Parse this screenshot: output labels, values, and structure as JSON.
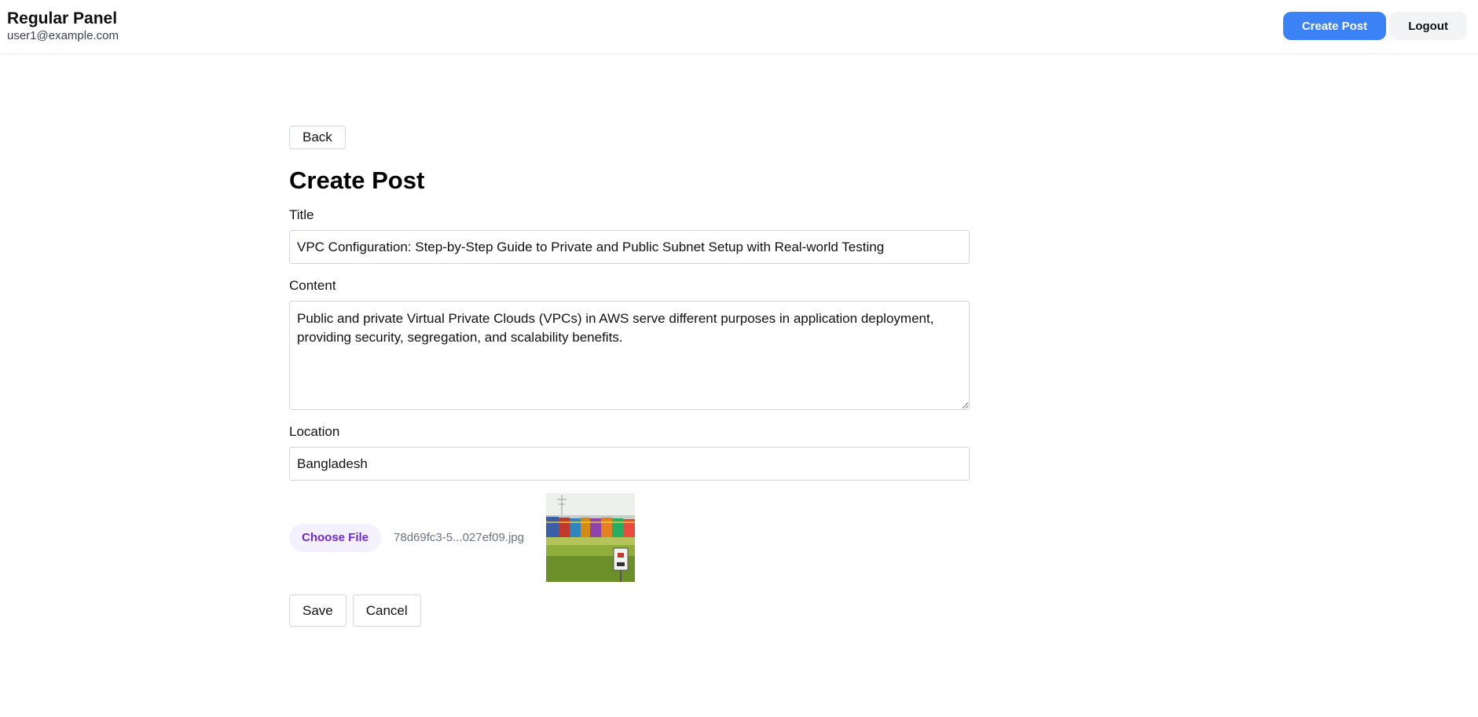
{
  "header": {
    "title": "Regular Panel",
    "email": "user1@example.com",
    "create_post_label": "Create Post",
    "logout_label": "Logout"
  },
  "form": {
    "back_label": "Back",
    "heading": "Create Post",
    "title_label": "Title",
    "title_value": "VPC Configuration: Step-by-Step Guide to Private and Public Subnet Setup with Real-world Testing",
    "content_label": "Content",
    "content_value": "Public and private Virtual Private Clouds (VPCs) in AWS serve different purposes in application deployment, providing security, segregation, and scalability benefits.",
    "location_label": "Location",
    "location_value": "Bangladesh",
    "choose_file_label": "Choose File",
    "file_name": "78d69fc3-5...027ef09.jpg",
    "save_label": "Save",
    "cancel_label": "Cancel"
  },
  "colors": {
    "primary": "#3b82f6",
    "file_button_bg": "#f3f0ff",
    "file_button_text": "#6d28d9"
  }
}
